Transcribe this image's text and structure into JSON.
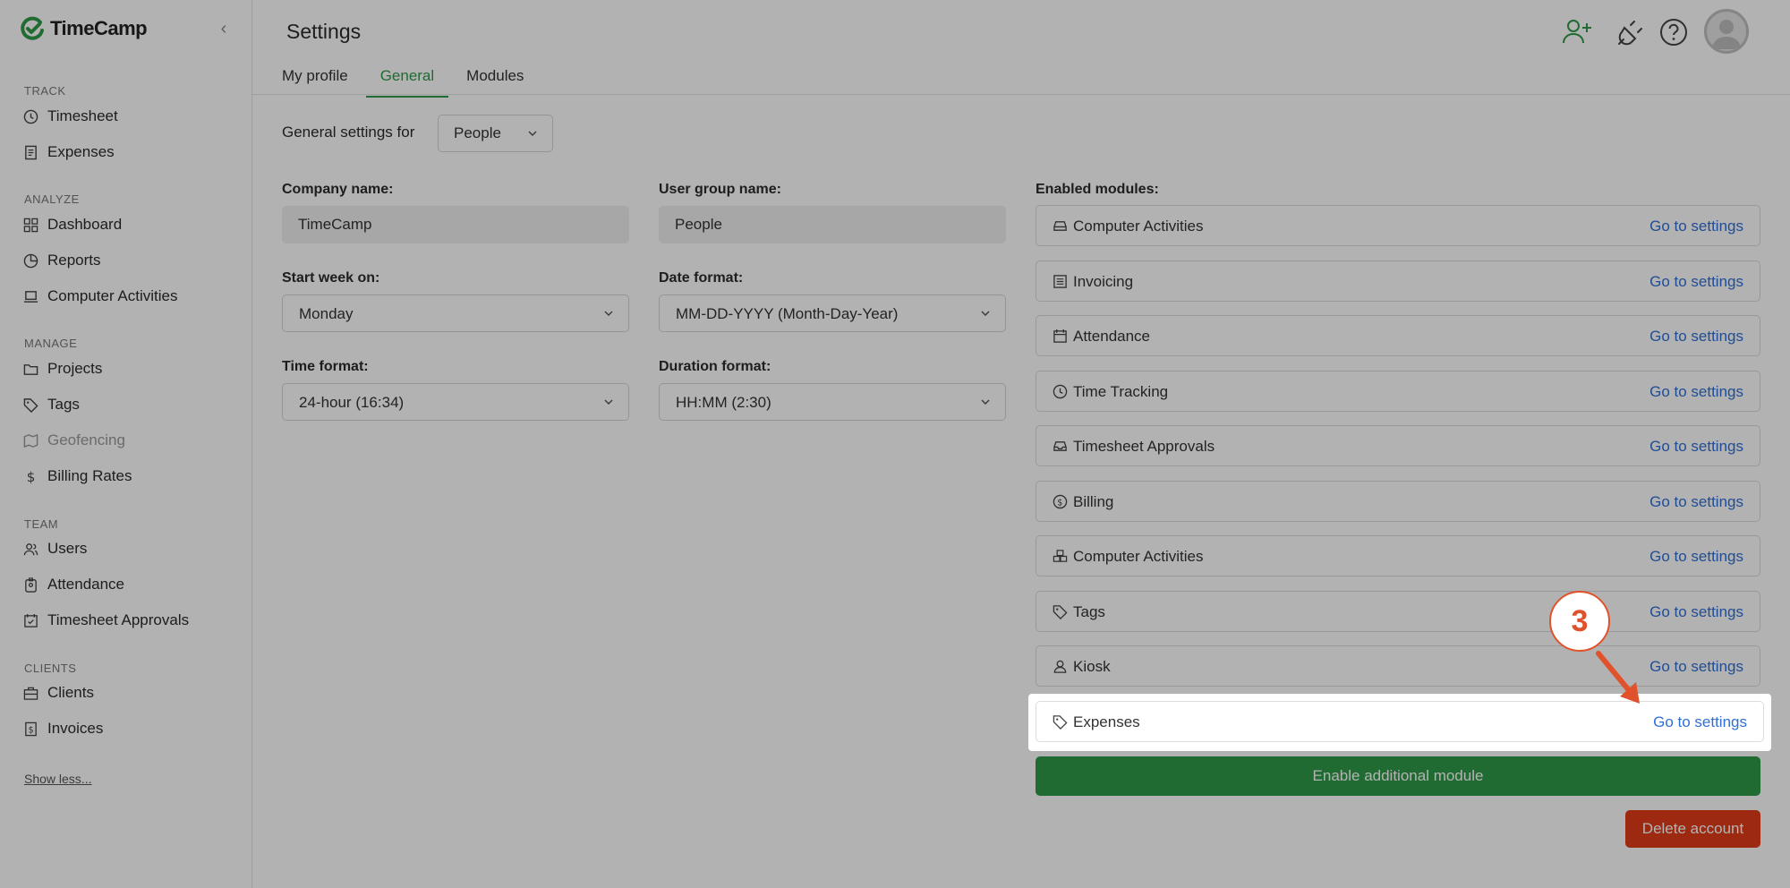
{
  "app": {
    "name": "TimeCamp",
    "brand_color": "#2e9a48"
  },
  "sidebar": {
    "sections": [
      {
        "label": "TRACK",
        "items": [
          {
            "label": "Timesheet",
            "icon": "clock-icon"
          },
          {
            "label": "Expenses",
            "icon": "receipt-icon"
          }
        ]
      },
      {
        "label": "ANALYZE",
        "items": [
          {
            "label": "Dashboard",
            "icon": "dashboard-icon"
          },
          {
            "label": "Reports",
            "icon": "pie-chart-icon"
          },
          {
            "label": "Computer Activities",
            "icon": "laptop-icon"
          }
        ]
      },
      {
        "label": "MANAGE",
        "items": [
          {
            "label": "Projects",
            "icon": "folder-icon"
          },
          {
            "label": "Tags",
            "icon": "tag-icon"
          },
          {
            "label": "Geofencing",
            "icon": "map-icon",
            "disabled": true
          },
          {
            "label": "Billing Rates",
            "icon": "dollar-icon"
          }
        ]
      },
      {
        "label": "TEAM",
        "items": [
          {
            "label": "Users",
            "icon": "users-icon"
          },
          {
            "label": "Attendance",
            "icon": "badge-icon"
          },
          {
            "label": "Timesheet Approvals",
            "icon": "calendar-check-icon"
          }
        ]
      },
      {
        "label": "CLIENTS",
        "items": [
          {
            "label": "Clients",
            "icon": "briefcase-icon"
          },
          {
            "label": "Invoices",
            "icon": "invoice-icon"
          }
        ]
      }
    ],
    "show_less": "Show less..."
  },
  "header": {
    "title": "Settings"
  },
  "tabs": [
    {
      "label": "My profile",
      "active": false
    },
    {
      "label": "General",
      "active": true
    },
    {
      "label": "Modules",
      "active": false
    }
  ],
  "general": {
    "settings_for_label": "General settings for",
    "settings_for_value": "People",
    "company_name_label": "Company name:",
    "company_name_value": "TimeCamp",
    "user_group_label": "User group name:",
    "user_group_value": "People",
    "start_week_label": "Start week on:",
    "start_week_value": "Monday",
    "date_format_label": "Date format:",
    "date_format_value": "MM-DD-YYYY (Month-Day-Year)",
    "time_format_label": "Time format:",
    "time_format_value": "24-hour (16:34)",
    "duration_format_label": "Duration format:",
    "duration_format_value": "HH:MM (2:30)"
  },
  "modules": {
    "label": "Enabled modules:",
    "link_label": "Go to settings",
    "items": [
      {
        "name": "Computer Activities",
        "icon": "monitor-icon"
      },
      {
        "name": "Invoicing",
        "icon": "list-icon"
      },
      {
        "name": "Attendance",
        "icon": "calendar-icon"
      },
      {
        "name": "Time Tracking",
        "icon": "clock-icon"
      },
      {
        "name": "Timesheet Approvals",
        "icon": "inbox-icon"
      },
      {
        "name": "Billing",
        "icon": "coin-icon"
      },
      {
        "name": "Computer Activities",
        "icon": "boxes-icon"
      },
      {
        "name": "Tags",
        "icon": "tag-icon"
      },
      {
        "name": "Kiosk",
        "icon": "person-icon"
      }
    ],
    "highlighted": {
      "name": "Expenses",
      "icon": "tag-icon"
    },
    "enable_button": "Enable additional module"
  },
  "delete_account": "Delete account",
  "tutorial": {
    "step": "3",
    "accent": "#e0522b"
  }
}
